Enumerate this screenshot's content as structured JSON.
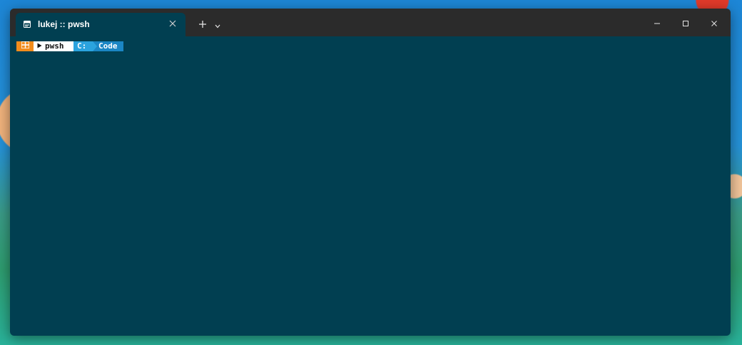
{
  "window": {
    "tab_title": "lukej :: pwsh",
    "tab_icon": "terminal-icon",
    "new_tab_icon": "plus-icon",
    "dropdown_icon": "chevron-down-icon",
    "minimize_icon": "minimize-icon",
    "maximize_icon": "maximize-icon",
    "close_icon": "close-icon"
  },
  "prompt": {
    "os_icon": "windows-logo-icon",
    "shell_icon": "play-triangle-icon",
    "shell": "pwsh",
    "drive": "C:",
    "directory": "Code"
  },
  "colors": {
    "terminal_background": "#013f51",
    "titlebar": "#2b2b2b",
    "prompt_os": "#f28c1c",
    "prompt_shell": "#ffffff",
    "prompt_drive": "#2ba3de",
    "prompt_dir": "#1b86c4"
  }
}
